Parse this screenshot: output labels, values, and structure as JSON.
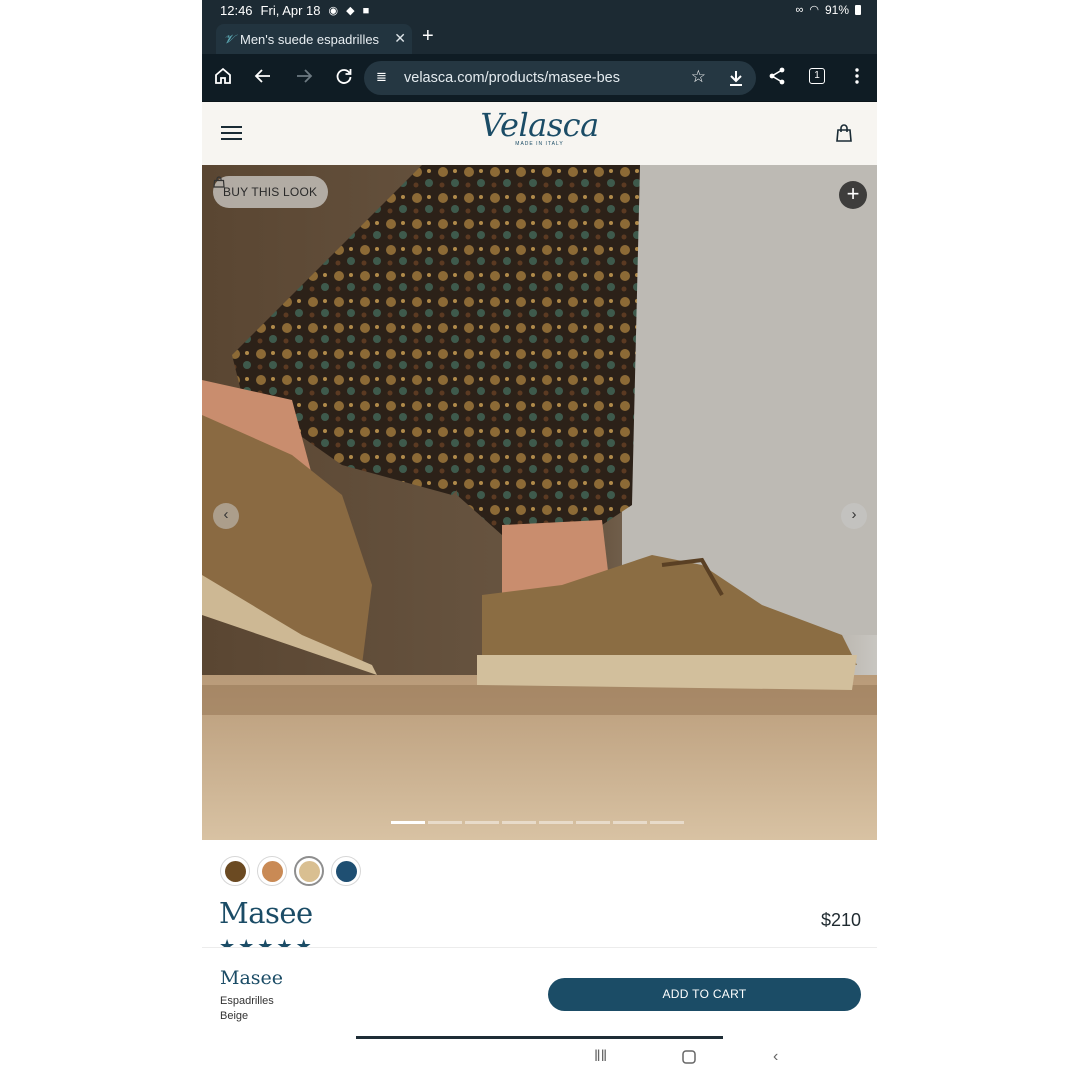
{
  "status_bar": {
    "time": "12:46",
    "date": "Fri, Apr 18",
    "battery": "91%"
  },
  "browser": {
    "tab_title": "Men's suede espadrilles",
    "url": "velasca.com/products/masee-bes",
    "tab_count": "1"
  },
  "site": {
    "logo_text": "Velasca",
    "logo_tagline": "MADE IN ITALY"
  },
  "hero": {
    "buy_look_label": "BUY THIS LOOK",
    "slide_count": 8,
    "active_slide": 1
  },
  "product": {
    "name": "Masee",
    "price": "$210",
    "swatches": [
      {
        "color": "#6b4a22",
        "selected": false
      },
      {
        "color": "#c98a55",
        "selected": false
      },
      {
        "color": "#d9bf91",
        "selected": true
      },
      {
        "color": "#1f4f72",
        "selected": false
      }
    ],
    "rating": 5
  },
  "sticky_bar": {
    "name": "Masee",
    "type": "Espadrilles",
    "color": "Beige",
    "add_to_cart_label": "ADD TO CART"
  },
  "colors": {
    "brand_navy": "#1b4c66",
    "browser_dark": "#0f1c24"
  }
}
